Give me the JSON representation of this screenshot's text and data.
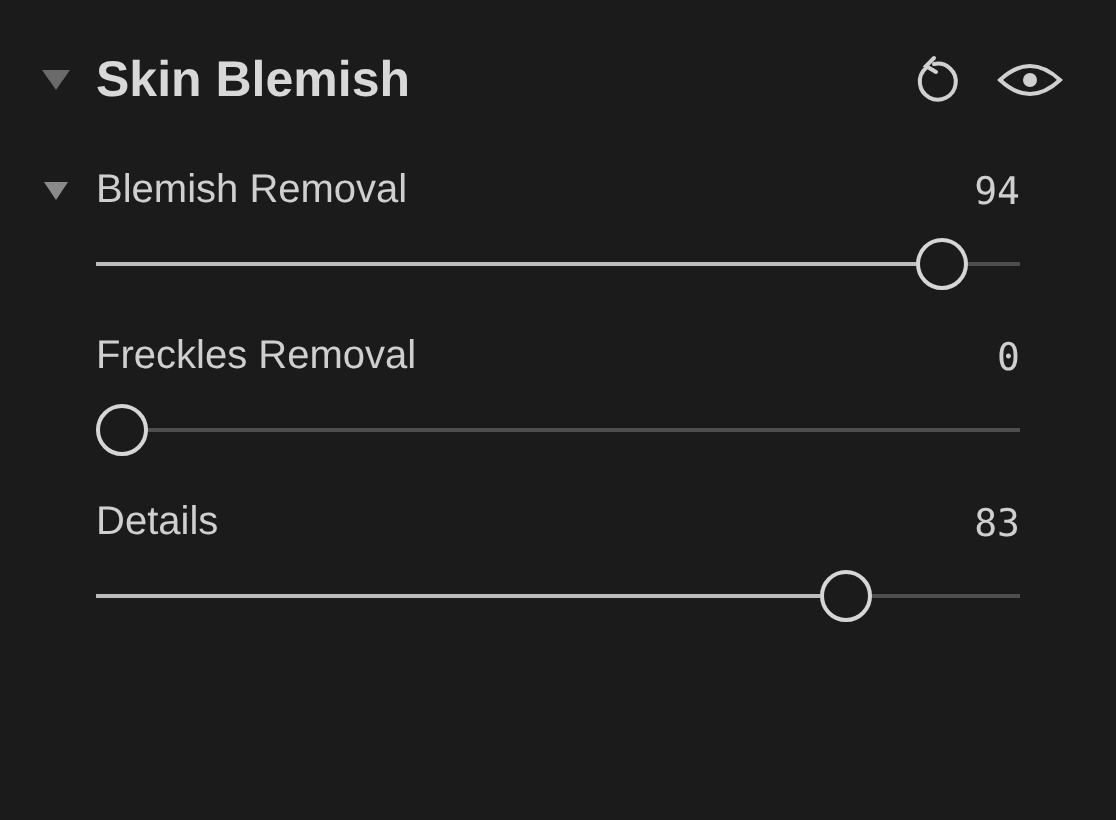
{
  "panel": {
    "title": "Skin Blemish",
    "expanded": true
  },
  "sliders": [
    {
      "kind": "group",
      "expanded": true,
      "label": "Blemish Removal",
      "value": "94",
      "level": 0.94
    },
    {
      "kind": "plain",
      "label": "Freckles Removal",
      "value": "0",
      "level": 0
    },
    {
      "kind": "plain",
      "label": "Details",
      "value": "83",
      "level": 0.83
    }
  ]
}
